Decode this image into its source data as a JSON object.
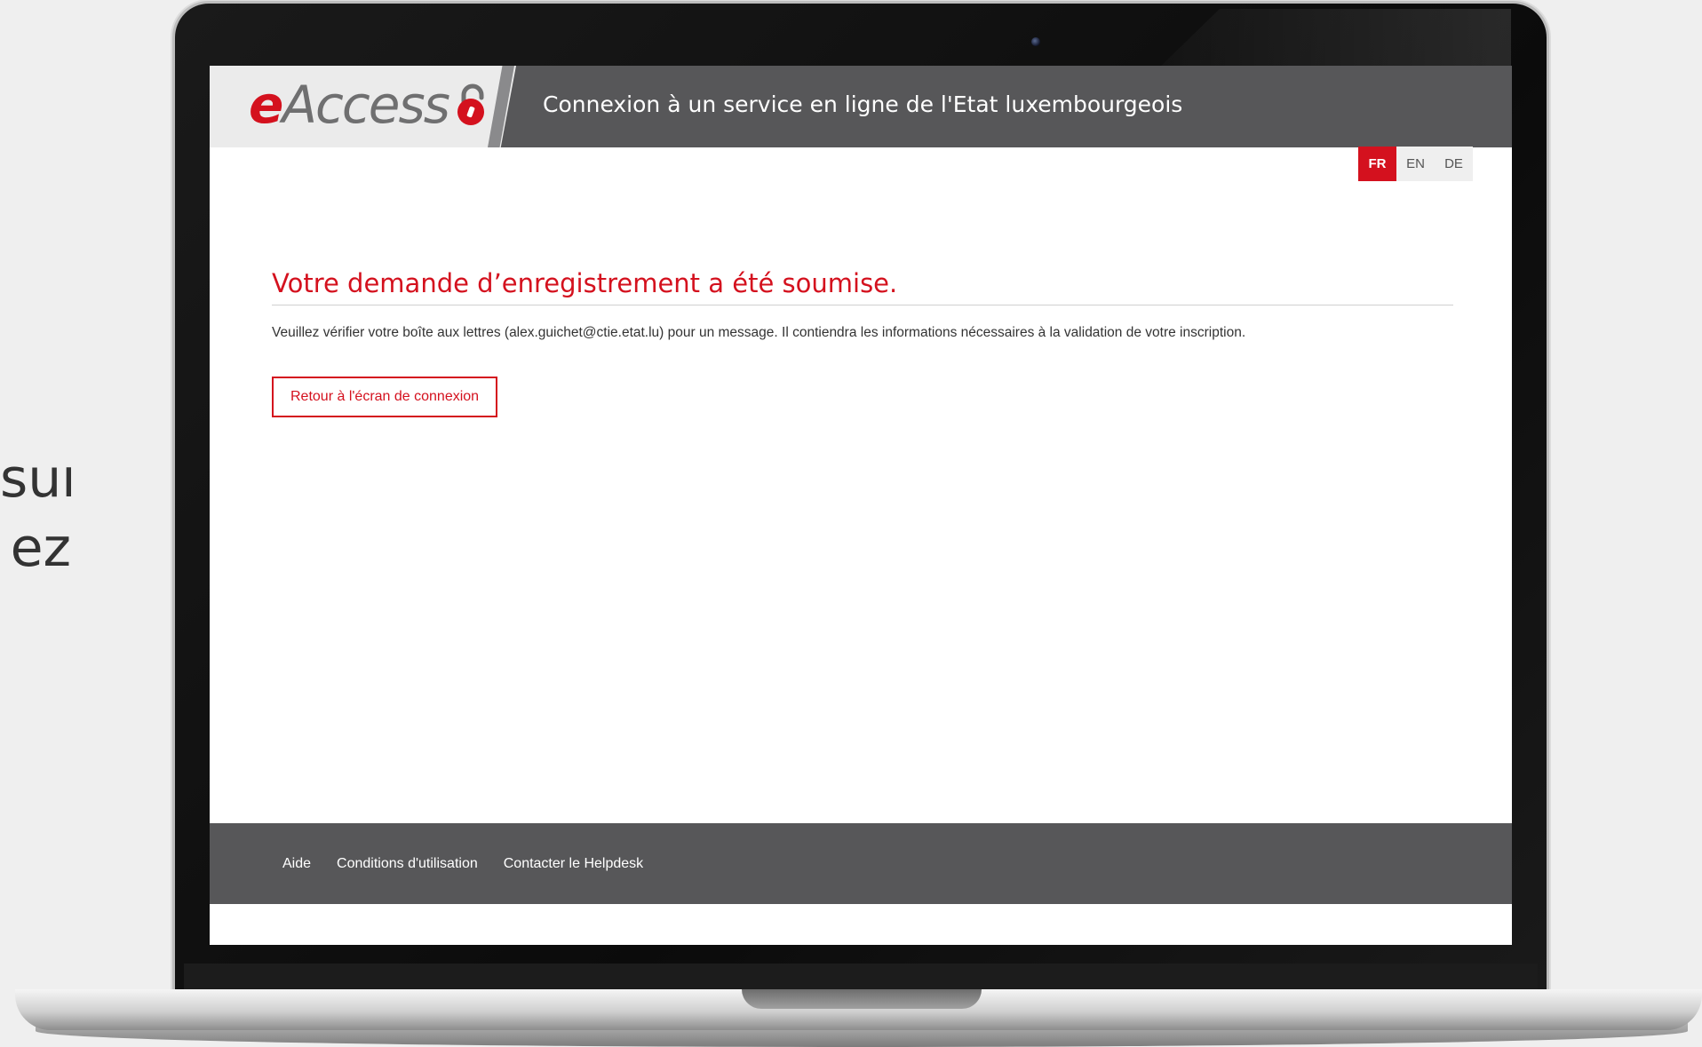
{
  "background_text": [
    "sur",
    "ez"
  ],
  "header": {
    "logo_text_e": "e",
    "logo_text_rest": "Access",
    "title": "Connexion à un service en ligne de l'Etat luxembourgeois"
  },
  "languages": [
    {
      "code": "FR",
      "active": true
    },
    {
      "code": "EN",
      "active": false
    },
    {
      "code": "DE",
      "active": false
    }
  ],
  "main": {
    "title": "Votre demande d’enregistrement a été soumise.",
    "message": "Veuillez vérifier votre boîte aux lettres (alex.guichet@ctie.etat.lu) pour un message. Il contiendra les informations nécessaires à la validation de votre inscription.",
    "back_button": "Retour à l'écran de connexion"
  },
  "footer": {
    "links": [
      "Aide",
      "Conditions d'utilisation",
      "Contacter le Helpdesk"
    ]
  },
  "colors": {
    "accent": "#d4111e",
    "header_bg": "#575759"
  }
}
